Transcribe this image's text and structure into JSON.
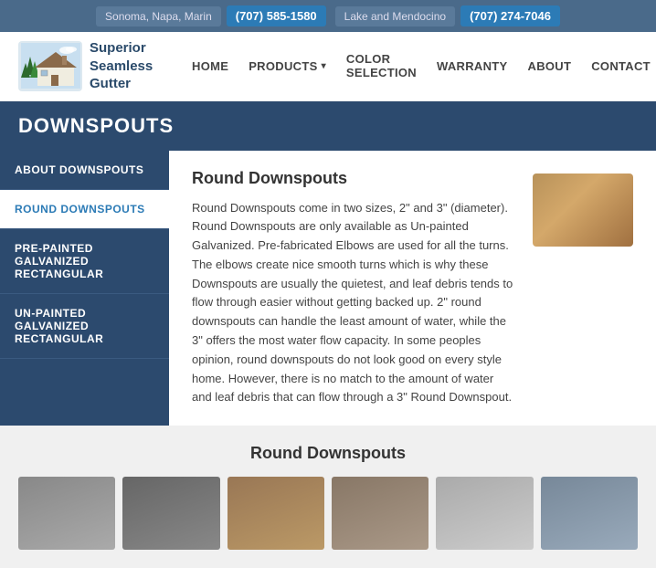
{
  "topbar": {
    "location1": "Sonoma, Napa, Marin",
    "phone1": "(707) 585-1580",
    "location2": "Lake and Mendocino",
    "phone2": "(707) 274-7046"
  },
  "logo": {
    "line1": "Superior",
    "line2": "Seamless",
    "line3": "Gutter"
  },
  "nav": {
    "home": "HOME",
    "products": "PRODUCTS",
    "color_selection": "COLOR SELECTION",
    "warranty": "WARRANTY",
    "about": "ABOUT",
    "contact": "CONTACT"
  },
  "page": {
    "title": "DOWNSPOUTS"
  },
  "sidebar": {
    "items": [
      {
        "id": "about-downspouts",
        "label": "ABOUT DOWNSPOUTS",
        "active": false
      },
      {
        "id": "round-downspouts",
        "label": "ROUND DOWNSPOUTS",
        "active": true
      },
      {
        "id": "pre-painted",
        "label": "PRE-PAINTED GALVANIZED RECTANGULAR",
        "active": false
      },
      {
        "id": "un-painted",
        "label": "UN-PAINTED GALVANIZED RECTANGULAR",
        "active": false
      }
    ]
  },
  "main": {
    "heading": "Round Downspouts",
    "body": "Round Downspouts come in two sizes, 2\" and 3\" (diameter). Round Downspouts are only available as Un-painted Galvanized. Pre-fabricated Elbows are used for all the turns. The elbows create nice smooth turns which is why these Downspouts are usually the quietest, and leaf debris tends to flow through easier without getting backed up. 2\" round downspouts can handle the least amount of water, while the 3\" offers the most water flow capacity. In some peoples opinion, round downspouts do not look good on every style home. However, there is no match to the amount of water and leaf debris that can flow through a 3\" Round Downspout."
  },
  "gallery": {
    "heading": "Round Downspouts"
  }
}
